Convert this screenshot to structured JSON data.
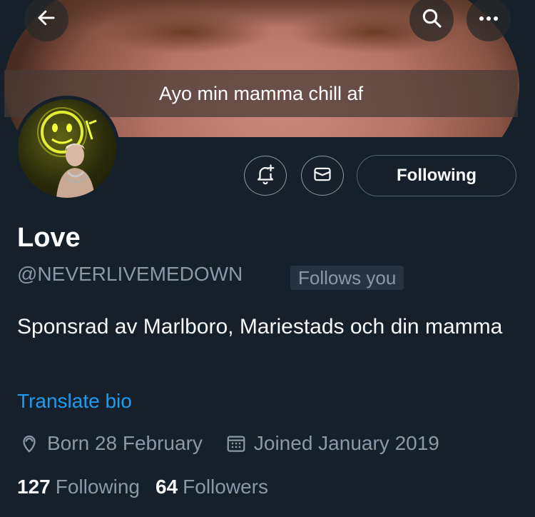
{
  "header": {
    "caption": "Ayo min mamma chill af"
  },
  "profile": {
    "name": "Love",
    "handle": "@NEVERLIVEMEDOWN",
    "follows_badge": "Follows you",
    "bio": "Sponsrad av Marlboro, Mariestads och din mamma",
    "translate_label": "Translate bio",
    "born": "Born 28 February",
    "joined": "Joined January 2019",
    "following_count": "127",
    "following_label": "Following",
    "followers_count": "64",
    "followers_label": "Followers"
  },
  "actions": {
    "follow_state_label": "Following"
  },
  "icons": {
    "back": "back-arrow-icon",
    "search": "search-icon",
    "more": "more-icon",
    "notify": "bell-plus-icon",
    "message": "envelope-icon",
    "location": "location-pin-icon",
    "calendar": "calendar-icon"
  },
  "colors": {
    "background": "#15202b",
    "accent": "#1d9bf0",
    "secondary_text": "#8b98a5"
  }
}
